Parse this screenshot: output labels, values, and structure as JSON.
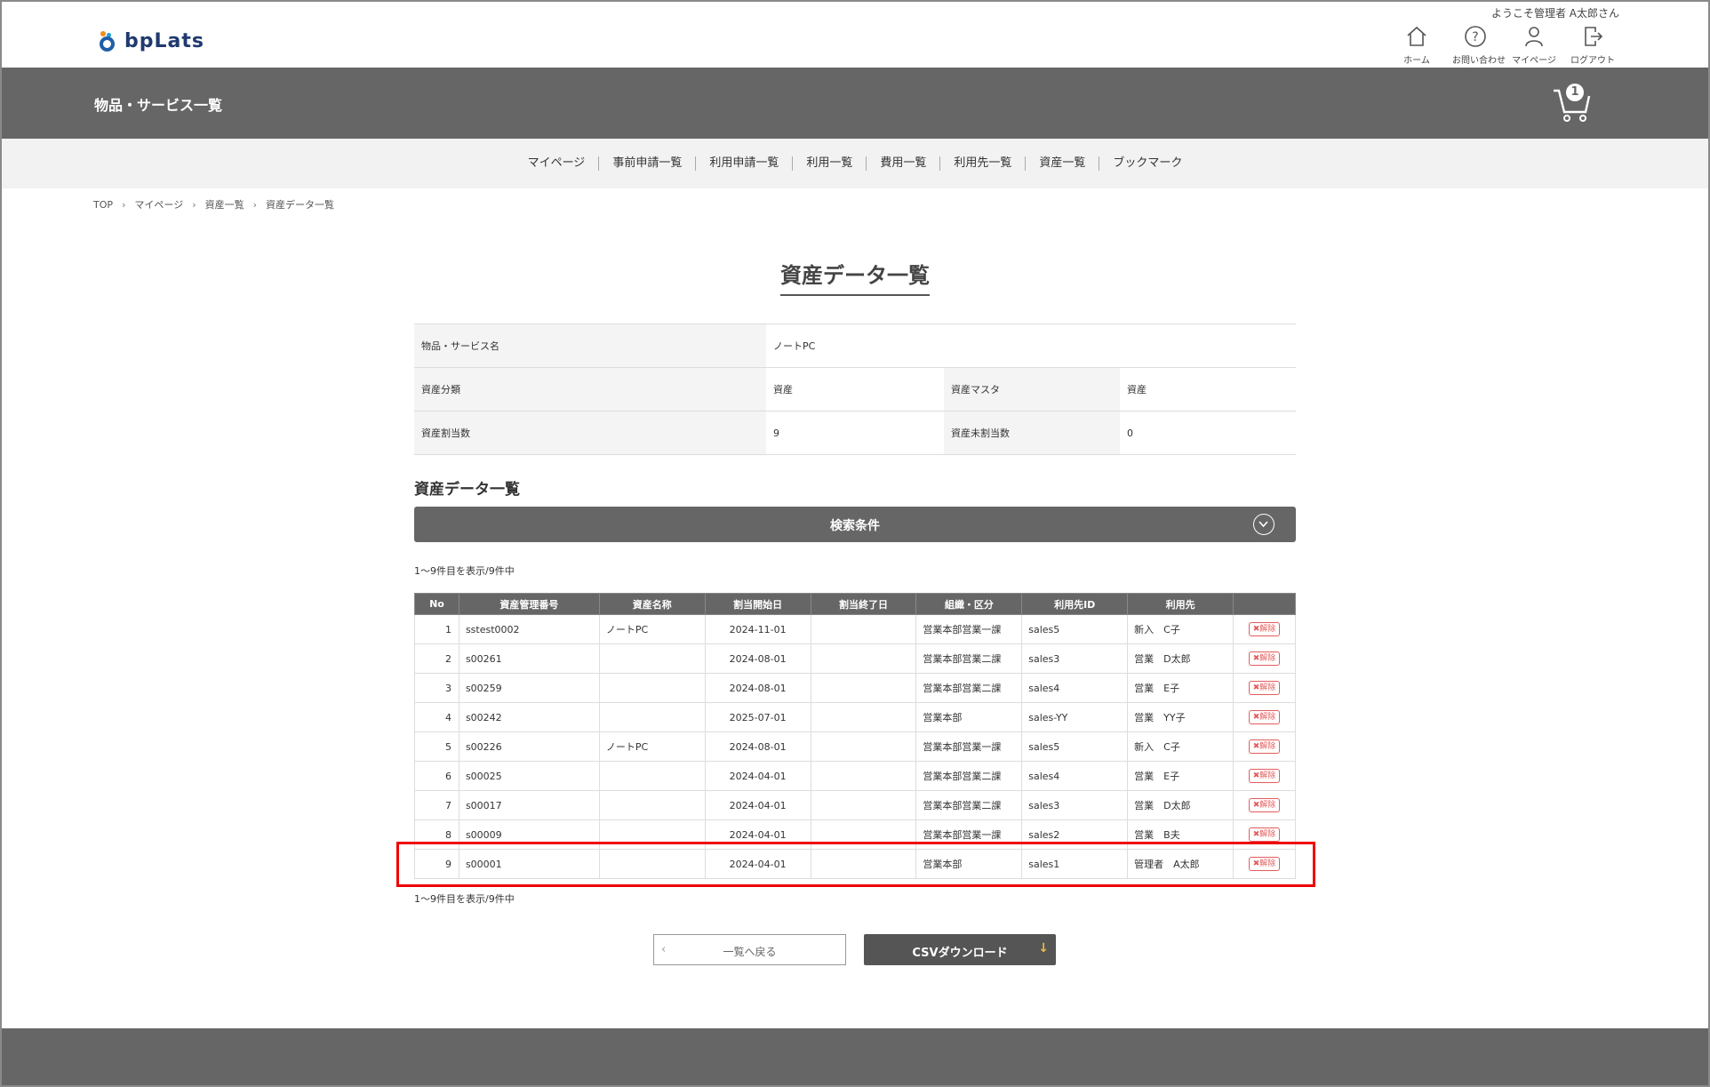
{
  "header": {
    "logo_text": "bpLats",
    "welcome": "ようこそ管理者 A太郎さん",
    "nav": [
      {
        "label": "ホーム",
        "icon": "home-icon"
      },
      {
        "label": "お問い合わせ",
        "icon": "help-icon"
      },
      {
        "label": "マイページ",
        "icon": "user-icon"
      },
      {
        "label": "ログアウト",
        "icon": "logout-icon"
      }
    ]
  },
  "titlebar": {
    "title": "物品・サービス一覧",
    "cart_count": "1"
  },
  "subnav": [
    "マイページ",
    "事前申請一覧",
    "利用申請一覧",
    "利用一覧",
    "費用一覧",
    "利用先一覧",
    "資産一覧",
    "ブックマーク"
  ],
  "breadcrumb": [
    "TOP",
    "マイページ",
    "資産一覧",
    "資産データ一覧"
  ],
  "page_title": "資産データ一覧",
  "info": {
    "product_label": "物品・サービス名",
    "product_value": "ノートPC",
    "category_label": "資産分類",
    "category_value": "資産",
    "master_label": "資産マスタ",
    "master_value": "資産",
    "assigned_label": "資産割当数",
    "assigned_value": "9",
    "unassigned_label": "資産未割当数",
    "unassigned_value": "0"
  },
  "section_title": "資産データ一覧",
  "search_label": "検索条件",
  "count_text": "1～9件目を表示/9件中",
  "table": {
    "headers": [
      "No",
      "資産管理番号",
      "資産名称",
      "割当開始日",
      "割当終了日",
      "組織・区分",
      "利用先ID",
      "利用先",
      ""
    ],
    "delete_label": "✖解除",
    "rows": [
      [
        "1",
        "sstest0002",
        "ノートPC",
        "2024-11-01",
        "",
        "営業本部営業一課",
        "sales5",
        "新入　C子"
      ],
      [
        "2",
        "s00261",
        "",
        "2024-08-01",
        "",
        "営業本部営業二課",
        "sales3",
        "営業　D太郎"
      ],
      [
        "3",
        "s00259",
        "",
        "2024-08-01",
        "",
        "営業本部営業二課",
        "sales4",
        "営業　E子"
      ],
      [
        "4",
        "s00242",
        "",
        "2025-07-01",
        "",
        "営業本部",
        "sales-YY",
        "営業　YY子"
      ],
      [
        "5",
        "s00226",
        "ノートPC",
        "2024-08-01",
        "",
        "営業本部営業一課",
        "sales5",
        "新入　C子"
      ],
      [
        "6",
        "s00025",
        "",
        "2024-04-01",
        "",
        "営業本部営業二課",
        "sales4",
        "営業　E子"
      ],
      [
        "7",
        "s00017",
        "",
        "2024-04-01",
        "",
        "営業本部営業二課",
        "sales3",
        "営業　D太郎"
      ],
      [
        "8",
        "s00009",
        "",
        "2024-04-01",
        "",
        "営業本部営業一課",
        "sales2",
        "営業　B夫"
      ],
      [
        "9",
        "s00001",
        "",
        "2024-04-01",
        "",
        "営業本部",
        "sales1",
        "管理者　A太郎"
      ]
    ]
  },
  "buttons": {
    "back": "一覧へ戻る",
    "csv": "CSVダウンロード"
  },
  "colors": {
    "dark_bar": "#666666",
    "highlight": "#ee0000",
    "logo_blue": "#1f5fa8",
    "delete_red": "#e45c5c"
  }
}
